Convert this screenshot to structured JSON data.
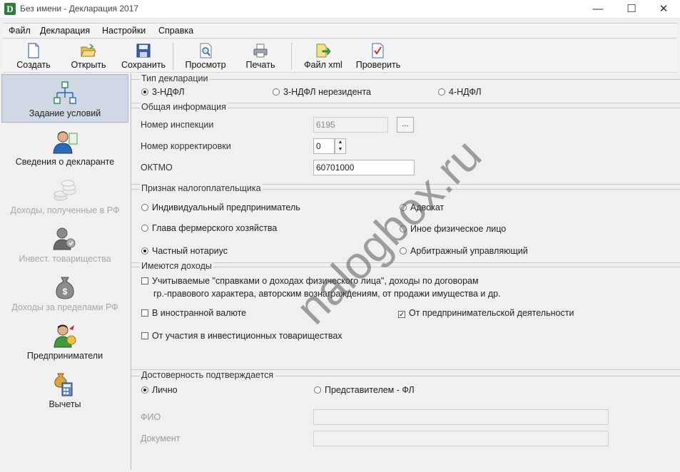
{
  "window": {
    "title": "Без имени - Декларация 2017",
    "app_icon_letter": "D",
    "minimize": "—",
    "maximize": "☐",
    "close": "✕"
  },
  "menu": [
    "Файл",
    "Декларация",
    "Настройки",
    "Справка"
  ],
  "toolbar": {
    "create": "Создать",
    "open": "Открыть",
    "save": "Сохранить",
    "preview": "Просмотр",
    "print": "Печать",
    "xml": "Файл xml",
    "check": "Проверить"
  },
  "nav": [
    {
      "label": "Задание условий",
      "active": true,
      "icon": "conditions-icon"
    },
    {
      "label": "Сведения о декларанте",
      "icon": "person-icon"
    },
    {
      "label": "Доходы, полученные в РФ",
      "disabled": true,
      "icon": "coins-icon"
    },
    {
      "label": "Инвест. товарищества",
      "disabled": true,
      "icon": "partnership-icon"
    },
    {
      "label": "Доходы за пределами РФ",
      "disabled": true,
      "icon": "money-bag-icon"
    },
    {
      "label": "Предприниматели",
      "icon": "entrepreneur-icon"
    },
    {
      "label": "Вычеты",
      "icon": "deductions-icon"
    }
  ],
  "decl_type": {
    "legend": "Тип декларации",
    "options": [
      "3-НДФЛ",
      "3-НДФЛ нерезидента",
      "4-НДФЛ"
    ],
    "selected": 0
  },
  "general": {
    "legend": "Общая информация",
    "inspection_label": "Номер инспекции",
    "inspection_value": "6195",
    "browse_label": "...",
    "correction_label": "Номер корректировки",
    "correction_value": "0",
    "oktmo_label": "ОКТМО",
    "oktmo_value": "60701000"
  },
  "taxpayer": {
    "legend": "Признак налогоплательщика",
    "options": [
      "Индивидуальный предприниматель",
      "Адвокат",
      "Глава фермерского хозяйства",
      "Иное физическое лицо",
      "Частный нотариус",
      "Арбитражный управляющий"
    ],
    "selected": 4
  },
  "income": {
    "legend": "Имеются доходы",
    "item1_line1": "Учитываемые \"справками о доходах физического лица\", доходы по договорам",
    "item1_line2": "гр.-правового характера, авторским вознаграждениям, от продажи имущества и др.",
    "foreign": "В иностранной валюте",
    "business": "От предпринимательской деятельности",
    "invest": "От участия в инвестиционных товариществах",
    "checked_business": true,
    "check_mark": "✓"
  },
  "confirm": {
    "legend": "Достоверность подтверждается",
    "personal": "Лично",
    "representative": "Представителем - ФЛ",
    "fio_label": "ФИО",
    "document_label": "Документ",
    "selected": 0
  },
  "watermark": "nalogbox.ru"
}
